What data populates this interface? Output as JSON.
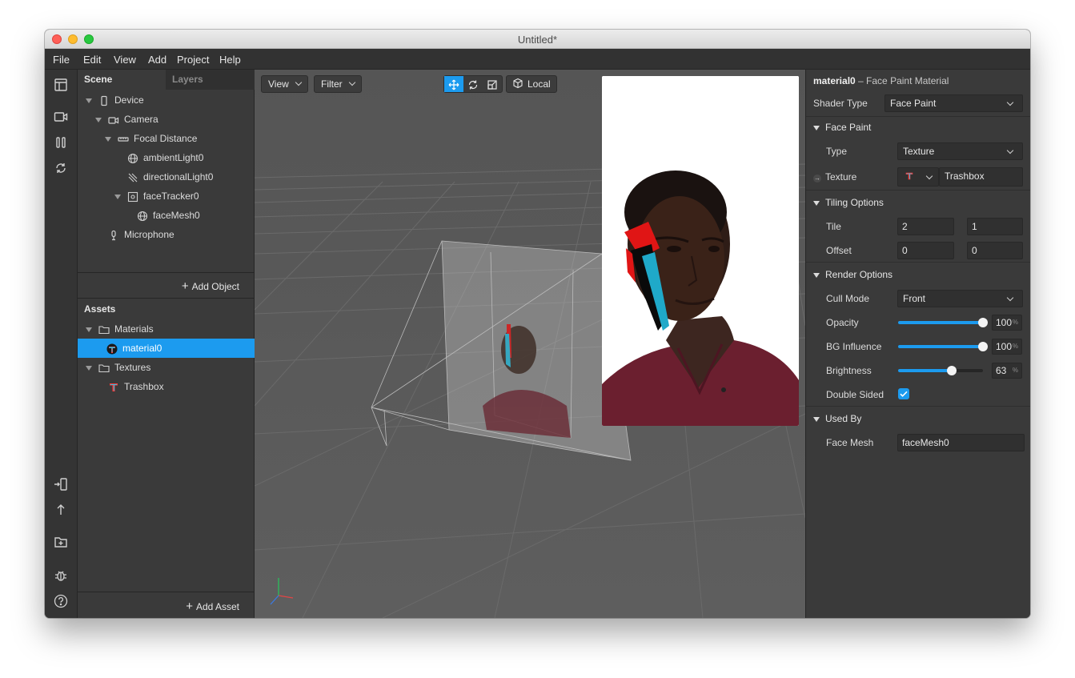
{
  "window": {
    "title": "Untitled*"
  },
  "menu": [
    "File",
    "Edit",
    "View",
    "Add",
    "Project",
    "Help"
  ],
  "scene_panel": {
    "tabs": {
      "scene": "Scene",
      "layers": "Layers"
    },
    "tree": {
      "device": "Device",
      "camera": "Camera",
      "focal_distance": "Focal Distance",
      "ambient_light": "ambientLight0",
      "directional_light": "directionalLight0",
      "face_tracker": "faceTracker0",
      "face_mesh": "faceMesh0",
      "microphone": "Microphone"
    },
    "add_object": "Add Object"
  },
  "assets_panel": {
    "title": "Assets",
    "materials_folder": "Materials",
    "material_item": "material0",
    "textures_folder": "Textures",
    "texture_item": "Trashbox",
    "add_asset": "Add Asset"
  },
  "viewport": {
    "view_label": "View",
    "filter_label": "Filter",
    "space_label": "Local",
    "active_tool": "move"
  },
  "inspector": {
    "object_name": "material0",
    "object_type": "– Face Paint Material",
    "shader_type": {
      "label": "Shader Type",
      "value": "Face Paint"
    },
    "face_paint": {
      "title": "Face Paint",
      "type": {
        "label": "Type",
        "value": "Texture"
      },
      "texture": {
        "label": "Texture",
        "value": "Trashbox"
      }
    },
    "tiling": {
      "title": "Tiling Options",
      "tile": {
        "label": "Tile",
        "x": "2",
        "y": "1"
      },
      "offset": {
        "label": "Offset",
        "x": "0",
        "y": "0"
      }
    },
    "render": {
      "title": "Render Options",
      "cull_mode": {
        "label": "Cull Mode",
        "value": "Front"
      },
      "opacity": {
        "label": "Opacity",
        "value": "100",
        "fraction": 1.0
      },
      "bg_influence": {
        "label": "BG Influence",
        "value": "100",
        "fraction": 1.0
      },
      "brightness": {
        "label": "Brightness",
        "value": "63",
        "fraction": 0.63
      },
      "double_sided": {
        "label": "Double Sided",
        "checked": true
      },
      "percent_symbol": "%"
    },
    "used_by": {
      "title": "Used By",
      "face_mesh": {
        "label": "Face Mesh",
        "value": "faceMesh0"
      }
    }
  },
  "colors": {
    "accent": "#1c9bef",
    "panel": "#3a3a3a",
    "viewport": "#5a5a5a"
  }
}
